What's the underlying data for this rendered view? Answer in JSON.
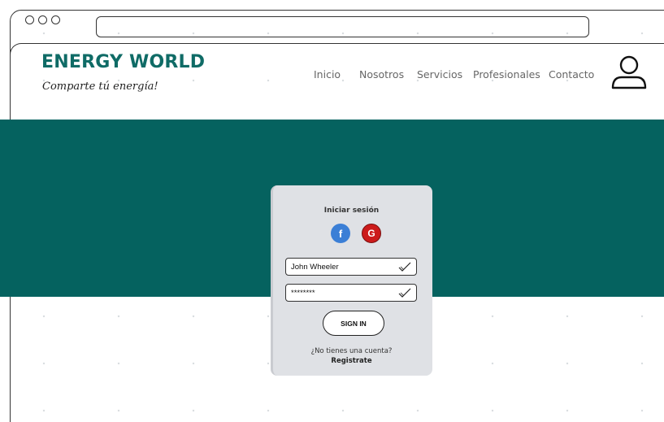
{
  "header": {
    "brand": "ENERGY WORLD",
    "tagline": "Comparte tú energía!"
  },
  "nav": {
    "items": [
      "Inicio",
      "Nosotros",
      "Servicios",
      "Profesionales",
      "Contacto"
    ]
  },
  "login": {
    "title": "Iniciar sesión",
    "facebook_label": "f",
    "google_label": "G",
    "username_value": "John Wheeler",
    "password_value": "********",
    "signin_label": "SIGN IN",
    "no_account_text": "¿No tienes una cuenta?",
    "register_label": "Registrate"
  },
  "colors": {
    "brand": "#0f6b66",
    "hero": "#05625f",
    "facebook": "#3b7fd6",
    "google": "#cc1b1b"
  },
  "icons": {
    "user": "user-icon",
    "check": "check-icon"
  }
}
